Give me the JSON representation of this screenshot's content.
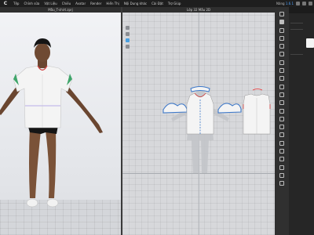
{
  "menubar": {
    "logo": "C",
    "items": [
      "Tệp",
      "Chỉnh sửa",
      "Vật Liệu",
      "Chiều",
      "Avatar",
      "Render",
      "Hiển Thị",
      "Nội Dung khác",
      "Cài Đặt",
      "Trợ Giúp"
    ],
    "version_label": "Nâng",
    "version_value": "1.6.1"
  },
  "window3d": {
    "title": "Mẫu_T-shirt.zprj"
  },
  "window2d": {
    "title": "Lớp 32 Mẫu 2D"
  },
  "colors": {
    "accent": "#4aa0e0",
    "pattern_outline": "#3d78c9",
    "garment": "#f4f4f4",
    "background_2d": "#d7d8db"
  }
}
